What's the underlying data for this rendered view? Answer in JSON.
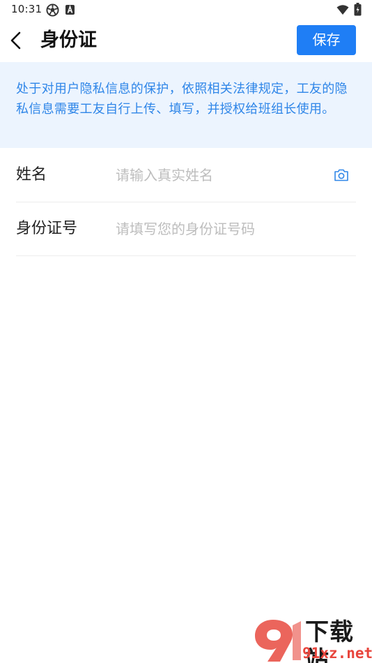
{
  "status_bar": {
    "time": "10:31",
    "icons": [
      "soccer-ball-icon",
      "a-badge-icon",
      "wifi-icon",
      "battery-icon"
    ]
  },
  "header": {
    "back_icon": "chevron-left-icon",
    "title": "身份证",
    "save_label": "保存"
  },
  "notice": {
    "text": "处于对用户隐私信息的保护，依照相关法律规定，工友的隐私信息需要工友自行上传、填写，并授权给班组长使用。"
  },
  "form": {
    "name": {
      "label": "姓名",
      "placeholder": "请输入真实姓名",
      "value": "",
      "icon": "camera-icon"
    },
    "id_number": {
      "label": "身份证号",
      "placeholder": "请填写您的身份证号码",
      "value": ""
    }
  },
  "watermark": {
    "brand": "下载站",
    "domain": "91xz.net"
  },
  "colors": {
    "accent": "#1f7ef5",
    "notice_bg": "#ecf4fe",
    "notice_text": "#2f86e8",
    "placeholder": "#bdbdbd"
  }
}
